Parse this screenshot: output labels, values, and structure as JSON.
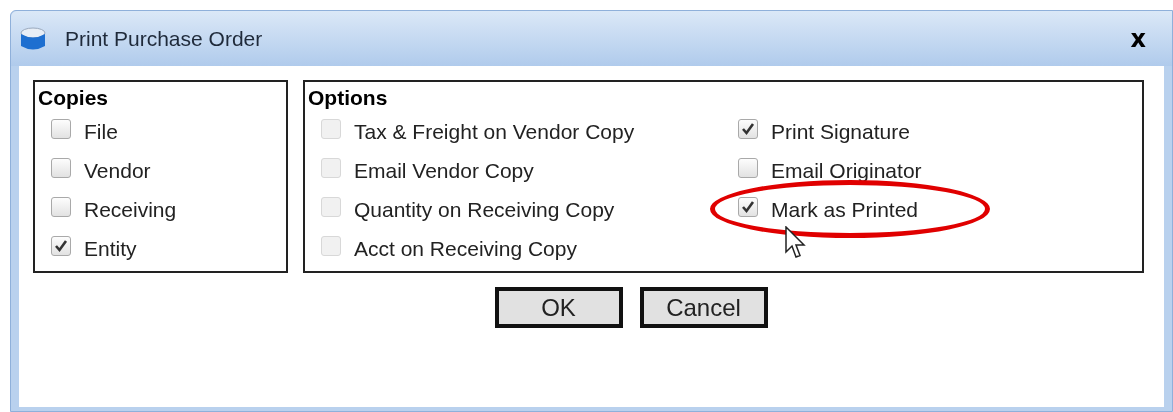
{
  "window": {
    "title": "Print Purchase Order",
    "close": "x"
  },
  "copies": {
    "title": "Copies",
    "items": [
      {
        "label": "File",
        "checked": false
      },
      {
        "label": "Vendor",
        "checked": false
      },
      {
        "label": "Receiving",
        "checked": false
      },
      {
        "label": "Entity",
        "checked": true
      }
    ]
  },
  "options": {
    "title": "Options",
    "columns": [
      [
        {
          "label": "Tax & Freight on Vendor Copy",
          "checked": false,
          "disabled": true,
          "highlighted": false
        },
        {
          "label": "Email Vendor Copy",
          "checked": false,
          "disabled": true,
          "highlighted": false
        },
        {
          "label": "Quantity on Receiving Copy",
          "checked": false,
          "disabled": true,
          "highlighted": false
        },
        {
          "label": "Acct on Receiving Copy",
          "checked": false,
          "disabled": true,
          "highlighted": false
        }
      ],
      [
        {
          "label": "Print Signature",
          "checked": true,
          "disabled": false,
          "highlighted": false
        },
        {
          "label": "Email Originator",
          "checked": false,
          "disabled": false,
          "highlighted": false
        },
        {
          "label": "Mark as Printed",
          "checked": true,
          "disabled": false,
          "highlighted": true
        }
      ]
    ]
  },
  "buttons": [
    "OK",
    "Cancel"
  ]
}
